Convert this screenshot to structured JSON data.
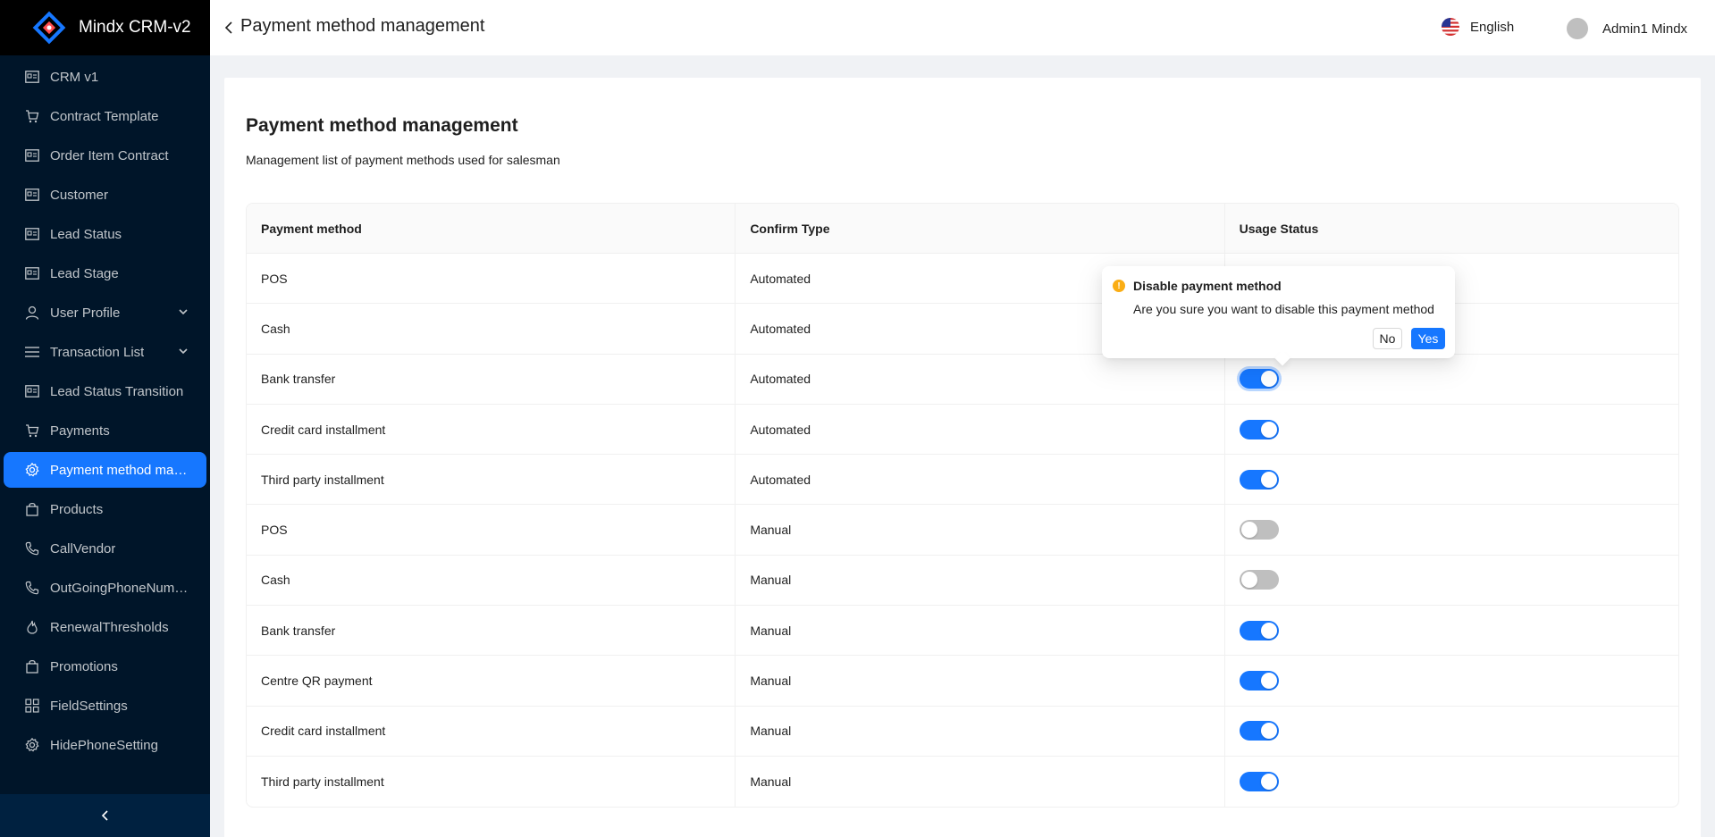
{
  "app": {
    "name": "Mindx CRM-v2"
  },
  "sidebar": {
    "items": [
      {
        "label": "CRM v1",
        "icon": "id-card-icon"
      },
      {
        "label": "Contract Template",
        "icon": "cart-icon"
      },
      {
        "label": "Order Item Contract",
        "icon": "id-card-icon"
      },
      {
        "label": "Customer",
        "icon": "id-card-icon"
      },
      {
        "label": "Lead Status",
        "icon": "id-card-icon"
      },
      {
        "label": "Lead Stage",
        "icon": "id-card-icon"
      },
      {
        "label": "User Profile",
        "icon": "user-icon",
        "expandable": true
      },
      {
        "label": "Transaction List",
        "icon": "list-icon",
        "expandable": true
      },
      {
        "label": "Lead Status Transition",
        "icon": "id-card-icon"
      },
      {
        "label": "Payments",
        "icon": "cart-icon"
      },
      {
        "label": "Payment method mana...",
        "icon": "gear-icon",
        "active": true
      },
      {
        "label": "Products",
        "icon": "shopping-bag-icon"
      },
      {
        "label": "CallVendor",
        "icon": "phone-icon"
      },
      {
        "label": "OutGoingPhoneNumber",
        "icon": "phone-icon"
      },
      {
        "label": "RenewalThresholds",
        "icon": "fire-icon"
      },
      {
        "label": "Promotions",
        "icon": "shopping-bag-icon"
      },
      {
        "label": "FieldSettings",
        "icon": "grid-icon"
      },
      {
        "label": "HidePhoneSetting",
        "icon": "gear-icon"
      }
    ]
  },
  "header": {
    "title": "Payment method management",
    "language": "English",
    "user": "Admin1 Mindx"
  },
  "page": {
    "title": "Payment method management",
    "description": "Management list of payment methods used for salesman"
  },
  "table": {
    "columns": [
      "Payment method",
      "Confirm Type",
      "Usage Status"
    ],
    "rows": [
      {
        "method": "POS",
        "confirm": "Automated",
        "enabled": true
      },
      {
        "method": "Cash",
        "confirm": "Automated",
        "enabled": true
      },
      {
        "method": "Bank transfer",
        "confirm": "Automated",
        "enabled": true
      },
      {
        "method": "Credit card installment",
        "confirm": "Automated",
        "enabled": true
      },
      {
        "method": "Third party installment",
        "confirm": "Automated",
        "enabled": true
      },
      {
        "method": "POS",
        "confirm": "Manual",
        "enabled": false
      },
      {
        "method": "Cash",
        "confirm": "Manual",
        "enabled": false
      },
      {
        "method": "Bank transfer",
        "confirm": "Manual",
        "enabled": true
      },
      {
        "method": "Centre QR payment",
        "confirm": "Manual",
        "enabled": true
      },
      {
        "method": "Credit card installment",
        "confirm": "Manual",
        "enabled": true
      },
      {
        "method": "Third party installment",
        "confirm": "Manual",
        "enabled": true
      }
    ]
  },
  "popconfirm": {
    "title": "Disable payment method",
    "description": "Are you sure you want to disable this payment method",
    "no_label": "No",
    "yes_label": "Yes",
    "icon": "exclamation-circle-icon"
  },
  "colors": {
    "primary": "#1677ff",
    "sidebar_bg": "#001529",
    "warning": "#faad14",
    "switch_off": "#bfbfbf"
  }
}
